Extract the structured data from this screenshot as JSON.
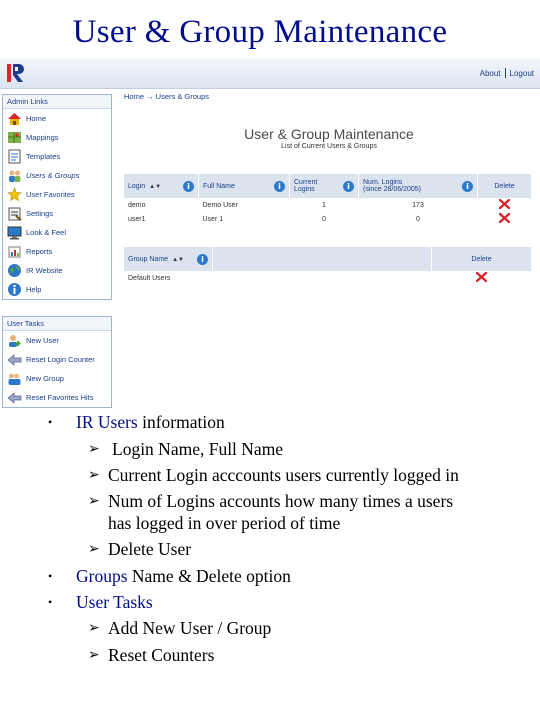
{
  "slide": {
    "title": "User & Group Maintenance"
  },
  "topbar": {
    "about": "About",
    "logout": "Logout"
  },
  "sidebar_admin": {
    "heading": "Admin Links",
    "items": [
      {
        "label": "Home",
        "icon": "home-icon",
        "active": false
      },
      {
        "label": "Mappings",
        "icon": "mappings-icon",
        "active": false
      },
      {
        "label": "Templates",
        "icon": "templates-icon",
        "active": false
      },
      {
        "label": "Users & Groups",
        "icon": "users-groups-icon",
        "active": true
      },
      {
        "label": "User Favorites",
        "icon": "star-icon",
        "active": false
      },
      {
        "label": "Settings",
        "icon": "settings-icon",
        "active": false
      },
      {
        "label": "Look & Feel",
        "icon": "look-feel-icon",
        "active": false
      },
      {
        "label": "Reports",
        "icon": "reports-icon",
        "active": false
      },
      {
        "label": "IR Website",
        "icon": "globe-icon",
        "active": false
      },
      {
        "label": "Help",
        "icon": "help-icon",
        "active": false
      }
    ]
  },
  "sidebar_tasks": {
    "heading": "User Tasks",
    "items": [
      {
        "label": "New User",
        "icon": "new-user-icon"
      },
      {
        "label": "Reset Login Counter",
        "icon": "reset-arrow-icon"
      },
      {
        "label": "New Group",
        "icon": "new-group-icon"
      },
      {
        "label": "Reset Favorites Hits",
        "icon": "reset-arrow-icon"
      }
    ]
  },
  "main": {
    "breadcrumb": "Home → Users & Groups",
    "title": "User & Group Maintenance",
    "subtitle": "List of Current Users & Groups",
    "users_table": {
      "col_login": "Login",
      "col_fullname": "Full Name",
      "col_current_1": "Current",
      "col_current_2": "Logins",
      "col_num_1": "Num. Logins",
      "col_num_2": "(since 28/06/2005)",
      "col_delete": "Delete",
      "rows": [
        {
          "login": "demo",
          "fullname": "Demo User",
          "current": "1",
          "num": "173"
        },
        {
          "login": "user1",
          "fullname": "User 1",
          "current": "0",
          "num": "0"
        }
      ]
    },
    "groups_table": {
      "col_name": "Group Name",
      "col_delete": "Delete",
      "rows": [
        {
          "name": "Default Users"
        }
      ]
    }
  },
  "bullets": {
    "b1_kw": "IR Users",
    "b1_rest": " information",
    "s1": "Login Name, Full Name",
    "s2": "Current Login acccounts users currently logged in",
    "s3a": "Num of Logins accounts how many times a users",
    "s3b": "has logged in over period of time",
    "s4": "Delete User",
    "b2_kw": "Groups",
    "b2_rest": " Name & Delete option",
    "b3_kw": "User Tasks",
    "s5": "Add New User / Group",
    "s6": "Reset Counters"
  },
  "colors": {
    "title": "#000c8a",
    "link": "#1c3f8c",
    "header_bg": "#dbe3ee",
    "delete_red": "#d8262a"
  }
}
